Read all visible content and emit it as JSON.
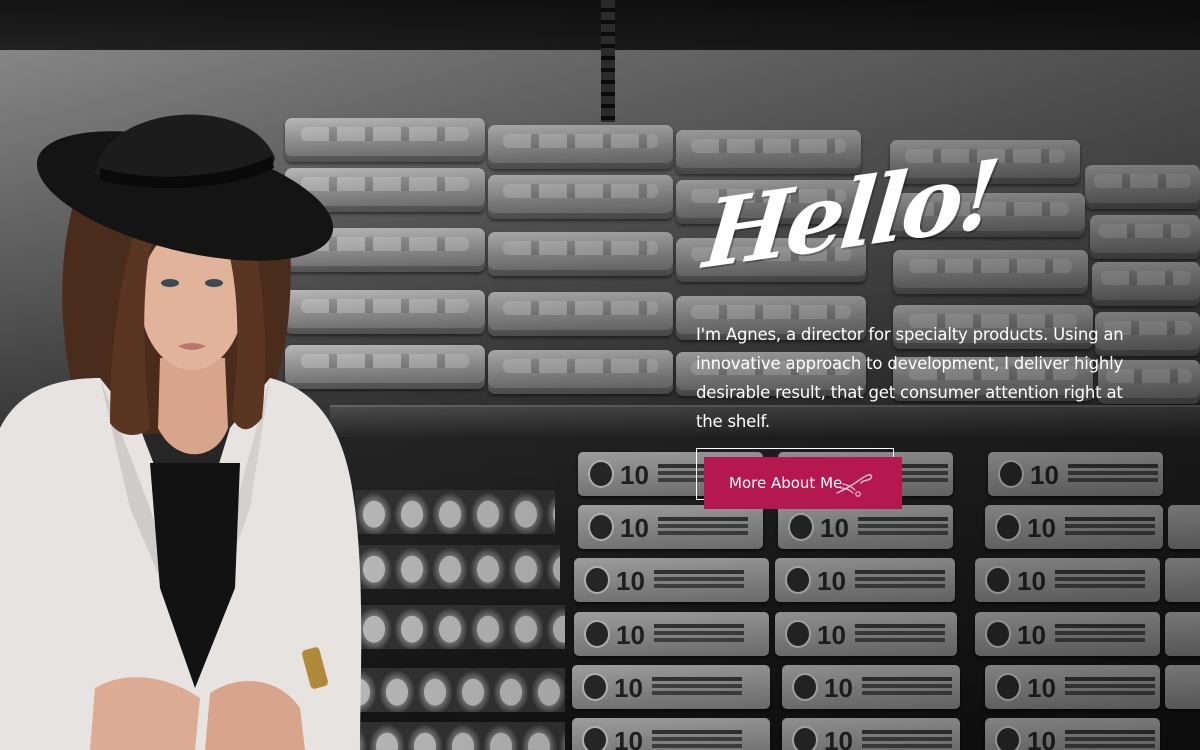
{
  "hero": {
    "heading": "Hello!",
    "intro": "I'm Agnes, a director for specialty products. Using an innovative approach to development, I deliver highly desirable result, that get consumer attention right at the shelf.",
    "cta_label": "More About Me",
    "cta_icon": "hand-pointer-icon",
    "accent_color": "#b5174f",
    "text_color": "#ffffff"
  },
  "background": {
    "carton_number": "10"
  }
}
